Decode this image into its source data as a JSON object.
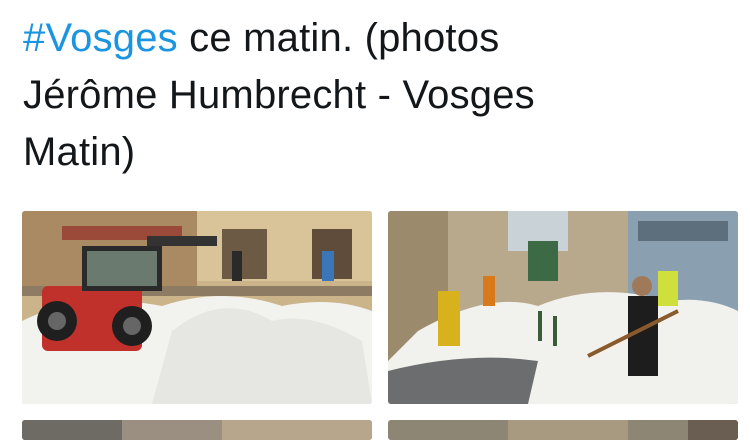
{
  "tweet": {
    "hashtag": "#Vosges",
    "text_line1_rest": " ce matin. (photos",
    "text_line2": "Jérôme Humbrecht - Vosges",
    "text_line3": "Matin)"
  },
  "media": {
    "photos": [
      {
        "alt": "hail-street-tractor-photo"
      },
      {
        "alt": "hail-street-shoveling-photo"
      },
      {
        "alt": "hail-photo-3"
      },
      {
        "alt": "hail-photo-4"
      }
    ]
  },
  "colors": {
    "text": "#14171a",
    "hashtag": "#1b95e0",
    "background": "#ffffff"
  }
}
